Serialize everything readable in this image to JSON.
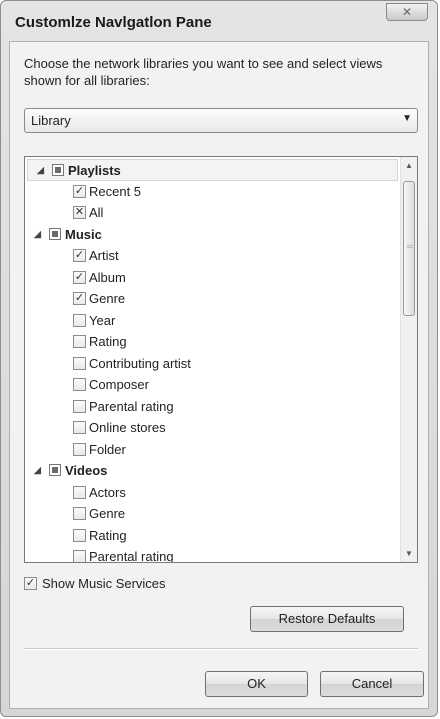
{
  "window": {
    "title": "Customlze Navlgatlon Pane",
    "close_label": "✕"
  },
  "description": "Choose the network libraries you want to see and select views shown for all libraries:",
  "library_select": {
    "value": "Library"
  },
  "tree": {
    "groups": [
      {
        "label": "Playlists",
        "items": [
          {
            "label": "Recent 5",
            "mark": "✓"
          },
          {
            "label": "All",
            "mark": "✕"
          }
        ]
      },
      {
        "label": "Music",
        "items": [
          {
            "label": "Artist",
            "mark": "✓"
          },
          {
            "label": "Album",
            "mark": "✓"
          },
          {
            "label": "Genre",
            "mark": "✓"
          },
          {
            "label": "Year",
            "mark": ""
          },
          {
            "label": "Rating",
            "mark": ""
          },
          {
            "label": "Contributing artist",
            "mark": ""
          },
          {
            "label": "Composer",
            "mark": ""
          },
          {
            "label": "Parental rating",
            "mark": ""
          },
          {
            "label": "Online stores",
            "mark": ""
          },
          {
            "label": "Folder",
            "mark": ""
          }
        ]
      },
      {
        "label": "Videos",
        "items": [
          {
            "label": "Actors",
            "mark": ""
          },
          {
            "label": "Genre",
            "mark": ""
          },
          {
            "label": "Rating",
            "mark": ""
          },
          {
            "label": "Parental rating",
            "mark": ""
          }
        ]
      }
    ]
  },
  "show_services": {
    "label": "Show Music Services",
    "mark": "✓"
  },
  "buttons": {
    "restore": "Restore Defaults",
    "ok": "OK",
    "cancel": "Cancel"
  }
}
